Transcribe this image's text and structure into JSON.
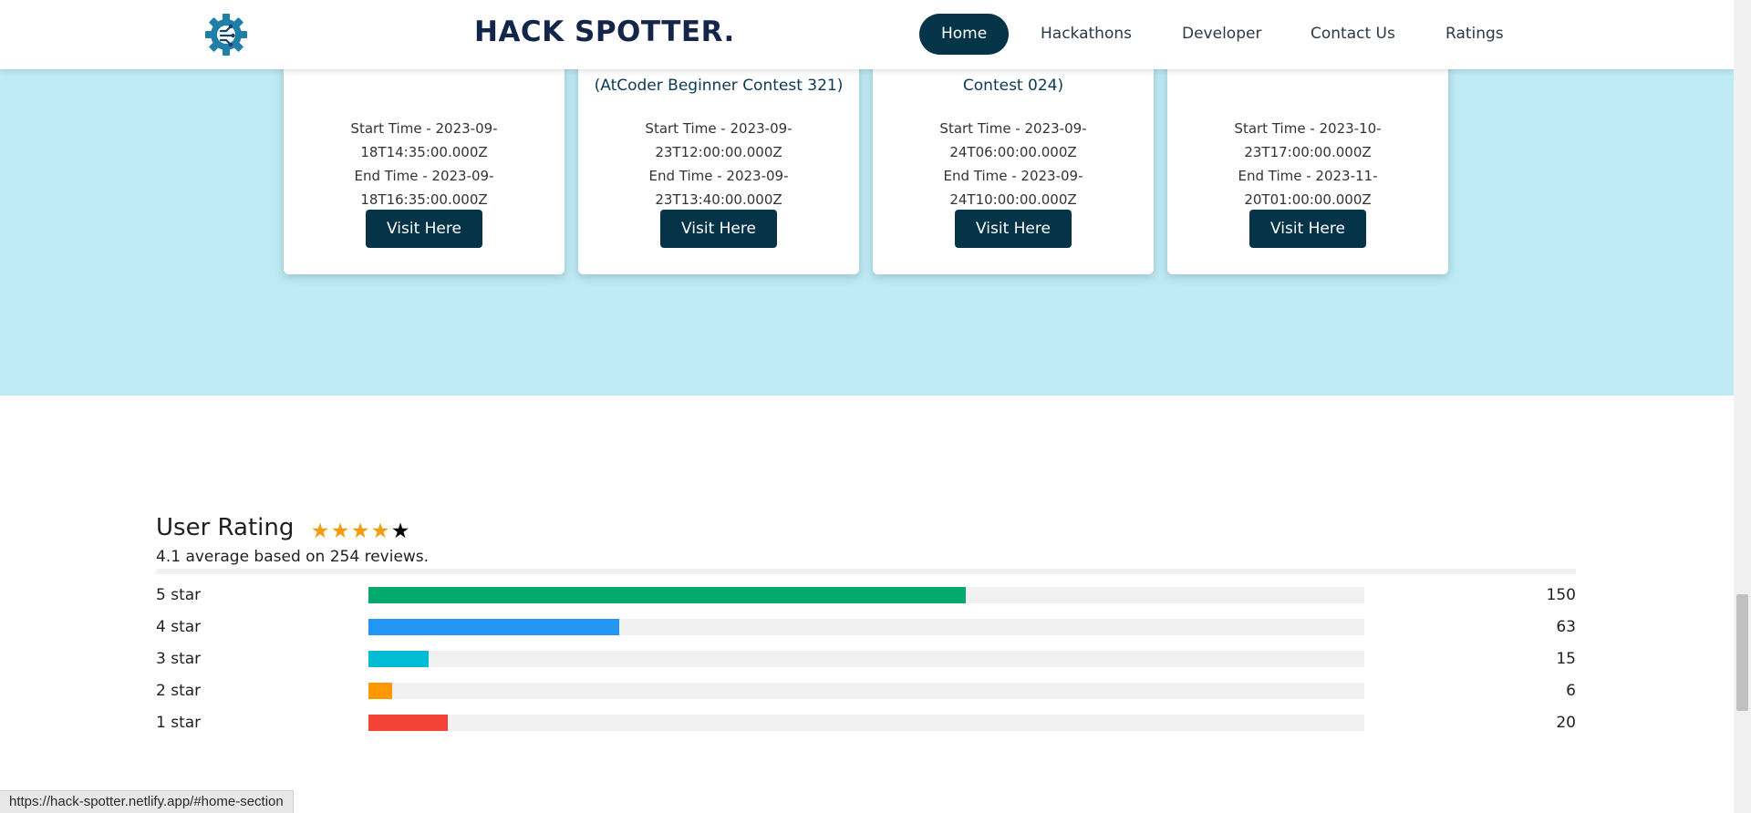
{
  "navbar": {
    "brand": "HACK SPOTTER.",
    "items": [
      {
        "label": "Home",
        "active": true
      },
      {
        "label": "Hackathons",
        "active": false
      },
      {
        "label": "Developer",
        "active": false
      },
      {
        "label": "Contact Us",
        "active": false
      },
      {
        "label": "Ratings",
        "active": false
      }
    ]
  },
  "contests": [
    {
      "title": "",
      "start": "Start Time - 2023-09-18T14:35:00.000Z",
      "end": "End Time - 2023-09-18T16:35:00.000Z",
      "button": "Visit Here"
    },
    {
      "title": "(AtCoder Beginner Contest 321)",
      "start": "Start Time - 2023-09-23T12:00:00.000Z",
      "end": "End Time - 2023-09-23T13:40:00.000Z",
      "button": "Visit Here"
    },
    {
      "title": "Contest 024)",
      "start": "Start Time - 2023-09-24T06:00:00.000Z",
      "end": "End Time - 2023-09-24T10:00:00.000Z",
      "button": "Visit Here"
    },
    {
      "title": "",
      "start": "Start Time - 2023-10-23T17:00:00.000Z",
      "end": "End Time - 2023-11-20T01:00:00.000Z",
      "button": "Visit Here"
    }
  ],
  "rating": {
    "title": "User Rating",
    "stars_filled": 4,
    "stars_total": 5,
    "summary": "4.1 average based on 254 reviews.",
    "rows": [
      {
        "label": "5 star",
        "count": "150",
        "value": 150,
        "color": "#04aa6d"
      },
      {
        "label": "4 star",
        "count": "63",
        "value": 63,
        "color": "#2196f3"
      },
      {
        "label": "3 star",
        "count": "15",
        "value": 15,
        "color": "#00bcd4"
      },
      {
        "label": "2 star",
        "count": "6",
        "value": 6,
        "color": "#ff9800"
      },
      {
        "label": "1 star",
        "count": "20",
        "value": 20,
        "color": "#f44336"
      }
    ],
    "bar_max": 250
  },
  "status_bar": {
    "url": "https://hack-spotter.netlify.app/#home-section"
  }
}
